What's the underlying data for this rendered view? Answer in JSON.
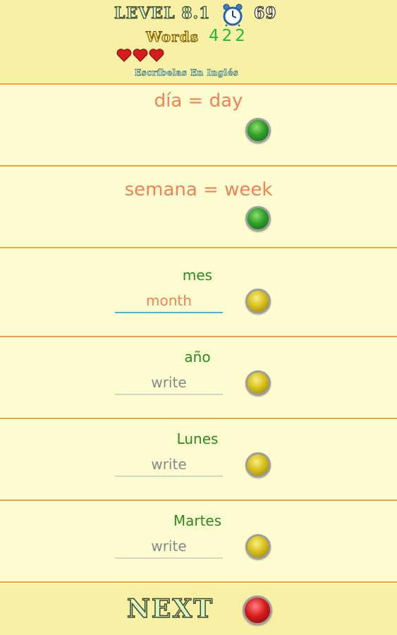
{
  "header": {
    "level_label": "LEVEL 8.1",
    "timer": "69",
    "words_label": "Words",
    "words_count": "422",
    "hearts": 3,
    "subtitle": "Escríbelas En Inglés"
  },
  "rows": [
    {
      "solved_text": "día = day",
      "status": "green"
    },
    {
      "solved_text": "semana = week",
      "status": "green"
    },
    {
      "word": "mes",
      "answer_value": "month",
      "status": "yellow"
    },
    {
      "word": "año",
      "answer_placeholder": "write",
      "status": "yellow"
    },
    {
      "word": "Lunes",
      "answer_placeholder": "write",
      "status": "yellow"
    },
    {
      "word": "Martes",
      "answer_placeholder": "write",
      "status": "yellow"
    }
  ],
  "footer": {
    "next_label": "NEXT",
    "next_status": "red"
  },
  "colors": {
    "background": "#fdfcd0",
    "header_bg": "#f8f0a4",
    "divider": "#f3a23f",
    "solved_text": "#f08158",
    "word_text": "#2c8a24"
  }
}
